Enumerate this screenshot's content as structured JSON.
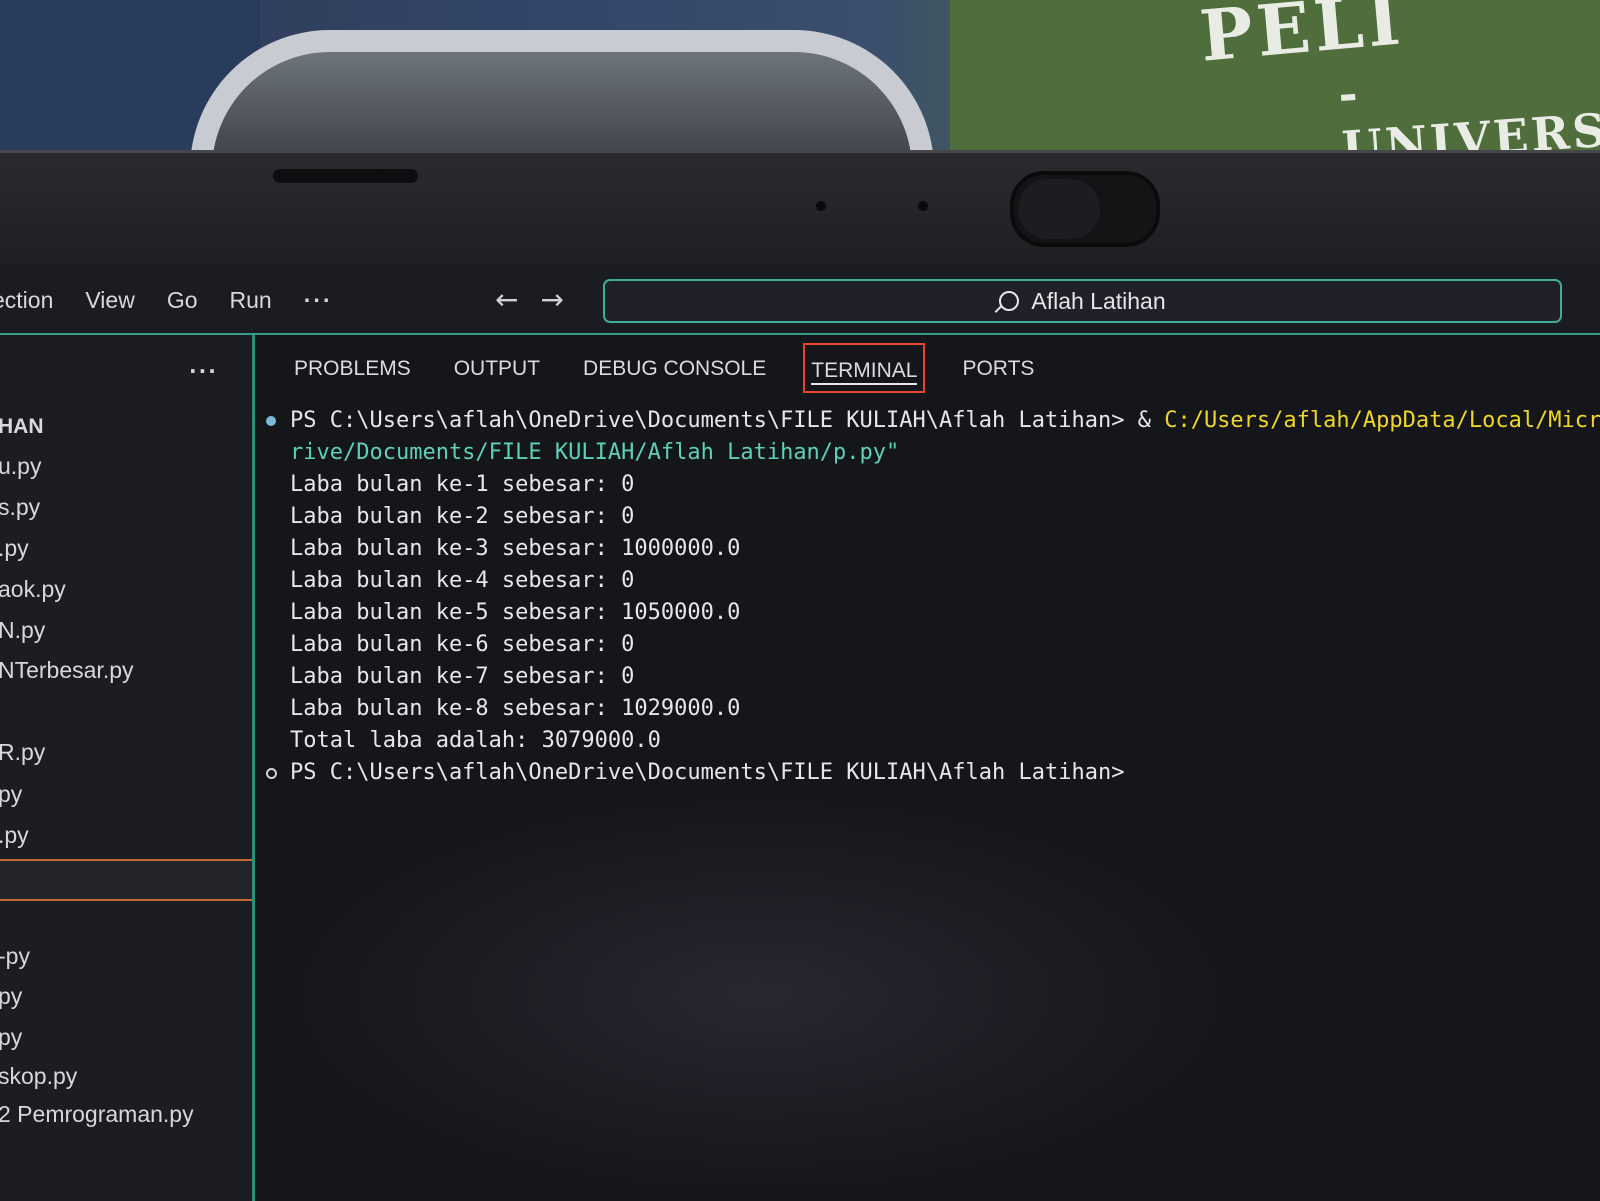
{
  "window": {
    "menu": [
      "ection",
      "View",
      "Go",
      "Run",
      "···"
    ],
    "nav": {
      "back": "←",
      "forward": "→"
    },
    "search_text": "Aflah Latihan"
  },
  "sidebar": {
    "more": "···",
    "section": "HAN",
    "files": [
      "u.py",
      "s.py",
      ".py",
      "aok.py",
      "N.py",
      "NTerbesar.py",
      "R.py",
      "py",
      ".py",
      "-py",
      "py",
      "py",
      "skop.py",
      "2 Pemrograman.py"
    ]
  },
  "panel": {
    "tabs": [
      "PROBLEMS",
      "OUTPUT",
      "DEBUG CONSOLE",
      "TERMINAL",
      "PORTS"
    ],
    "active_tab": "TERMINAL"
  },
  "terminal": {
    "prompt1": "PS C:\\Users\\aflah\\OneDrive\\Documents\\FILE KULIAH\\Aflah Latihan>",
    "amp": " & ",
    "cmd_path": "C:/Users/aflah/AppData/Local/Micros",
    "cmd_cont": "rive/Documents/FILE KULIAH/Aflah Latihan/p.py\"",
    "output": [
      "Laba bulan ke-1 sebesar: 0",
      "Laba bulan ke-2 sebesar: 0",
      "Laba bulan ke-3 sebesar: 1000000.0",
      "Laba bulan ke-4 sebesar: 0",
      "Laba bulan ke-5 sebesar: 1050000.0",
      "Laba bulan ke-6 sebesar: 0",
      "Laba bulan ke-7 sebesar: 0",
      "Laba bulan ke-8 sebesar: 1029000.0",
      "Total laba adalah: 3079000.0"
    ],
    "prompt2": "PS C:\\Users\\aflah\\OneDrive\\Documents\\FILE KULIAH\\Aflah Latihan>"
  },
  "photo": {
    "shirt_print_line1": "PELI",
    "shirt_print_line2": "-UNIVERS"
  },
  "colors": {
    "accent_teal": "#3fae98",
    "active_tab_border": "#e6452c",
    "selected_border": "#c36a2d",
    "path_yellow": "#f0d52b",
    "path_teal": "#5fd0b8"
  }
}
